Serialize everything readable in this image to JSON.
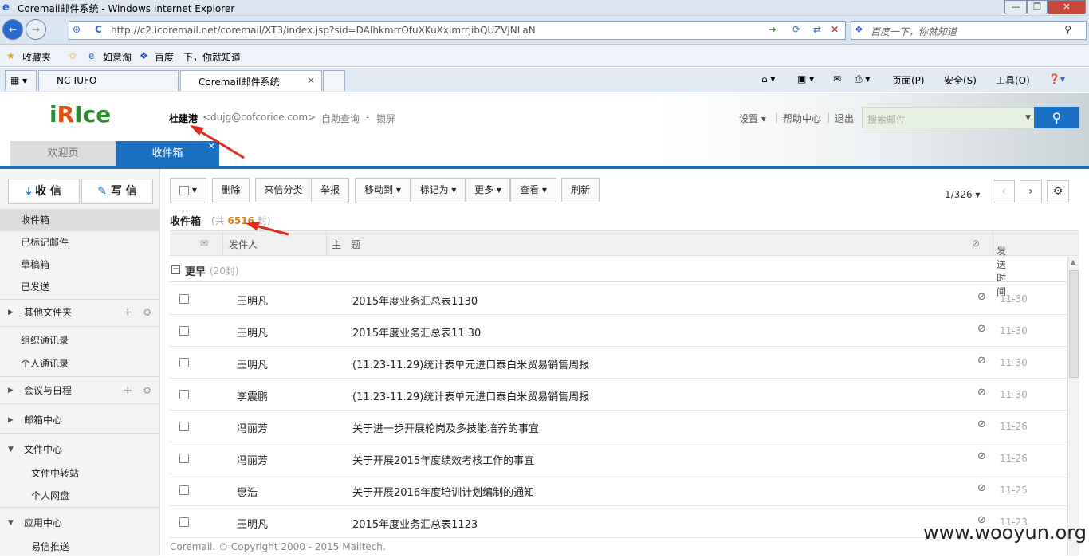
{
  "window": {
    "title": "Coremail邮件系统 - Windows Internet Explorer"
  },
  "browser": {
    "url": "http://c2.icoremail.net/coremail/XT3/index.jsp?sid=DAIhkmrrOfuXKuXxlmrrjibQUZVjNLaN",
    "search_placeholder": "百度一下，你就知道",
    "favorites": {
      "label": "收藏夹",
      "links": [
        "如意淘",
        "百度一下，你就知道"
      ]
    },
    "tabs": [
      {
        "label": "NC-IUFO"
      },
      {
        "label": "Coremail邮件系统"
      }
    ],
    "commands": [
      "页面(P)",
      "安全(S)",
      "工具(O)"
    ]
  },
  "header": {
    "logo": {
      "a": "i",
      "b": "R",
      "c": "Ice"
    },
    "user_name": "杜建港",
    "user_email": "<dujg@cofcorice.com>",
    "self_query": "自助查询",
    "lock": "锁屏",
    "settings": "设置",
    "help": "帮助中心",
    "logout": "退出",
    "search_placeholder": "搜索邮件"
  },
  "tabs": {
    "welcome": "欢迎页",
    "inbox": "收件箱"
  },
  "sidebar": {
    "receive": "收 信",
    "compose": "写 信",
    "items": {
      "inbox": "收件箱",
      "flagged": "已标记邮件",
      "drafts": "草稿箱",
      "sent": "已发送",
      "other": "其他文件夹",
      "org_contacts": "组织通讯录",
      "personal_contacts": "个人通讯录",
      "calendar": "会议与日程",
      "mail_center": "邮箱中心",
      "file_center": "文件中心",
      "file_transfer": "文件中转站",
      "netdisk": "个人网盘",
      "app_center": "应用中心",
      "yixin": "易信推送"
    }
  },
  "toolbar": {
    "delete": "删除",
    "classify": "来信分类",
    "report": "举报",
    "move": "移动到",
    "mark": "标记为",
    "more": "更多",
    "view": "查看",
    "refresh": "刷新",
    "pager": "1/326"
  },
  "list": {
    "title": "收件箱",
    "count_prefix": "(共 ",
    "count": "6516",
    "count_suffix": " 封)",
    "col_from": "发件人",
    "col_subject": "主　题",
    "col_date": "发送时间",
    "group_label": "更早",
    "group_count": "(20封)",
    "rows": [
      {
        "from": "王明凡",
        "subject": "2015年度业务汇总表1130",
        "date": "11-30"
      },
      {
        "from": "王明凡",
        "subject": "2015年度业务汇总表11.30",
        "date": "11-30"
      },
      {
        "from": "王明凡",
        "subject": "(11.23-11.29)统计表单元进口泰白米贸易销售周报",
        "date": "11-30"
      },
      {
        "from": "李震鹏",
        "subject": "(11.23-11.29)统计表单元进口泰白米贸易销售周报",
        "date": "11-30"
      },
      {
        "from": "冯丽芳",
        "subject": "关于进一步开展轮岗及多技能培养的事宜",
        "date": "11-26"
      },
      {
        "from": "冯丽芳",
        "subject": "关于开展2015年度绩效考核工作的事宜",
        "date": "11-26"
      },
      {
        "from": "惠浩",
        "subject": "关于开展2016年度培训计划编制的通知",
        "date": "11-25"
      },
      {
        "from": "王明凡",
        "subject": "2015年度业务汇总表1123",
        "date": "11-23"
      }
    ]
  },
  "footer": "Coremail. © Copyright 2000 - 2015 Mailtech.",
  "watermark": "www.wooyun.org"
}
